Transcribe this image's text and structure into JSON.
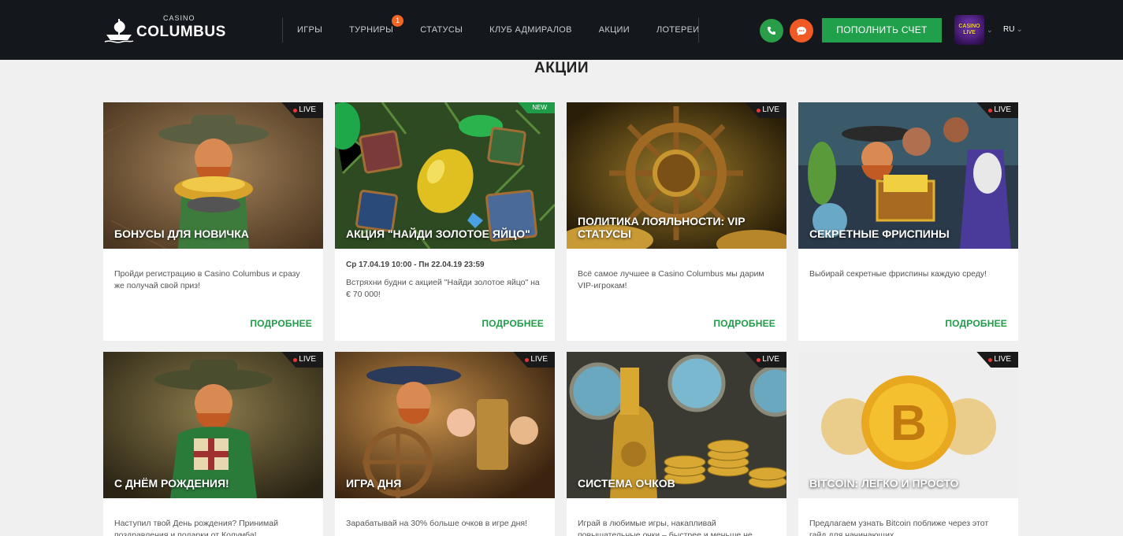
{
  "header": {
    "logo_small": "CASINO",
    "logo_big": "COLUMBUS",
    "nav": [
      {
        "label": "ИГРЫ"
      },
      {
        "label": "ТУРНИРЫ",
        "badge": "1"
      },
      {
        "label": "СТАТУСЫ"
      },
      {
        "label": "КЛУБ АДМИРАЛОВ"
      },
      {
        "label": "АКЦИИ"
      },
      {
        "label": "ЛОТЕРЕИ"
      }
    ],
    "deposit_label": "ПОПОЛНИТЬ СЧЕТ",
    "live_logo_line1": "CASINO",
    "live_logo_line2": "LIVE",
    "language": "RU",
    "chevron": "⌄"
  },
  "page_title": "АКЦИИ",
  "cards": [
    {
      "badge": "LIVE",
      "title": "БОНУСЫ ДЛЯ НОВИЧКА",
      "date": "",
      "desc": "Пройди регистрацию в Casino Columbus и сразу же получай свой приз!",
      "more": "ПОДРОБНЕЕ"
    },
    {
      "badge": "NEW",
      "title": "АКЦИЯ \"НАЙДИ ЗОЛОТОЕ ЯЙЦО\"",
      "date": "Ср 17.04.19 10:00 - Пн 22.04.19 23:59",
      "desc": "Встряхни будни с акцией \"Найди золотое яйцо\" на € 70 000!",
      "more": "ПОДРОБНЕЕ"
    },
    {
      "badge": "LIVE",
      "title": "ПОЛИТИКА ЛОЯЛЬНОСТИ: VIP СТАТУСЫ",
      "date": "",
      "desc": "Всё самое лучшее в Casino Columbus мы дарим VIP-игрокам!",
      "more": "ПОДРОБНЕЕ"
    },
    {
      "badge": "LIVE",
      "title": "СЕКРЕТНЫЕ ФРИСПИНЫ",
      "date": "",
      "desc": "Выбирай секретные фриспины каждую среду!",
      "more": "ПОДРОБНЕЕ"
    },
    {
      "badge": "LIVE",
      "title": "С ДНЁМ РОЖДЕНИЯ!",
      "desc": "Наступил твой День рождения? Принимай поздравления и подарки от Колумба!"
    },
    {
      "badge": "LIVE",
      "title": "ИГРА ДНЯ",
      "desc": "Зарабатывай на 30% больше очков в игре дня!"
    },
    {
      "badge": "LIVE",
      "title": "СИСТЕМА ОЧКОВ",
      "desc": "Играй в любимые игры, накапливай повышательные очки – быстрее и меньше не ..."
    },
    {
      "badge": "LIVE",
      "title": "BITCOIN: ЛЕГКО И ПРОСТО",
      "desc": "Предлагаем узнать Bitcoin поближе через этот гайд для начинающих"
    }
  ],
  "colors": {
    "accent_green": "#1f9c48",
    "header_bg": "#14181d",
    "chat_orange": "#f15a24"
  }
}
